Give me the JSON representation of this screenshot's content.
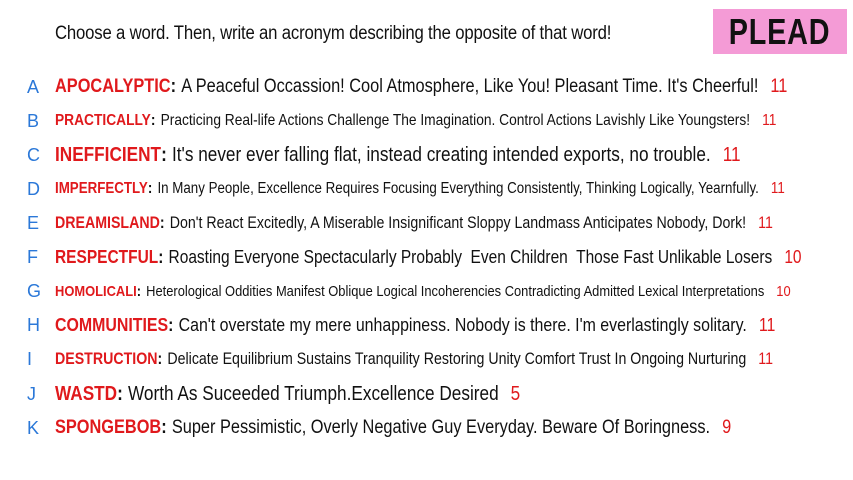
{
  "prompt": "Choose a word. Then, write an acronym describing the opposite of that word!",
  "badge": {
    "label": "PLEAD",
    "color": "#f49bd6"
  },
  "colors": {
    "letter": "#2b78d8",
    "word": "#e0191c",
    "count": "#e0191c",
    "text": "#111111"
  },
  "entries": [
    {
      "letter": "A",
      "word": "APOCALYPTIC",
      "phrase": "A Peaceful Occassion! Cool Atmosphere, Like You! Pleasant Time. It's Cheerful!",
      "count": "11"
    },
    {
      "letter": "B",
      "word": "PRACTICALLY",
      "phrase": "Practicing Real-life Actions Challenge The Imagination. Control Actions Lavishly Like Youngsters!",
      "count": "11"
    },
    {
      "letter": "C",
      "word": "INEFFICIENT",
      "phrase": "It's never ever falling flat, instead creating intended exports, no trouble.",
      "count": "11"
    },
    {
      "letter": "D",
      "word": "IMPERFECTLY",
      "phrase": "In Many People, Excellence Requires Focusing Everything Consistently, Thinking Logically, Yearnfully.",
      "count": "11"
    },
    {
      "letter": "E",
      "word": "DREAMISLAND",
      "phrase": "Don't React Excitedly, A Miserable Insignificant Sloppy Landmass Anticipates Nobody, Dork!",
      "count": "11"
    },
    {
      "letter": "F",
      "word": "RESPECTFUL",
      "phrase": "Roasting Everyone Spectacularly Probably  Even Children  Those Fast Unlikable Losers",
      "count": "10"
    },
    {
      "letter": "G",
      "word": "HOMOLICALI",
      "phrase": "Heterological Oddities Manifest Oblique Logical Incoherencies Contradicting Admitted Lexical Interpretations",
      "count": "10"
    },
    {
      "letter": "H",
      "word": "COMMUNITIES",
      "phrase": "Can't overstate my mere unhappiness. Nobody is there. I'm everlastingly solitary.",
      "count": "11"
    },
    {
      "letter": "I",
      "word": "DESTRUCTION",
      "phrase": "Delicate Equilibrium Sustains Tranquility Restoring Unity Comfort Trust In Ongoing Nurturing",
      "count": "11"
    },
    {
      "letter": "J",
      "word": "WASTD",
      "phrase": "Worth As Suceeded Triumph.Excellence Desired",
      "count": "5"
    },
    {
      "letter": "K",
      "word": "SPONGEBOB",
      "phrase": "Super Pessimistic, Overly Negative Guy Everyday. Beware Of Boringness.",
      "count": "9"
    }
  ]
}
